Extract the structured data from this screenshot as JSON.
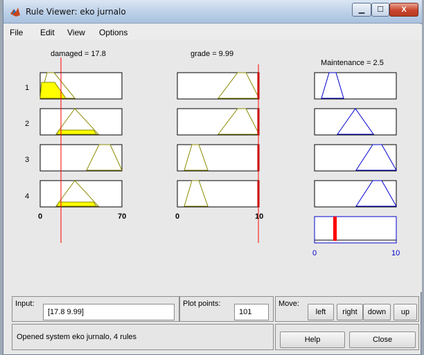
{
  "window": {
    "title": "Rule Viewer: eko jurnalo"
  },
  "titlebar_buttons": {
    "minimize": "▁",
    "maximize": "☐",
    "close": "X"
  },
  "menu": {
    "file": "File",
    "edit": "Edit",
    "view": "View",
    "options": "Options"
  },
  "inputs": [
    {
      "name": "damaged",
      "value": "17.8",
      "header": "damaged = 17.8",
      "range_min": "0",
      "range_max": "70"
    },
    {
      "name": "grade",
      "value": "9.99",
      "header": "grade = 9.99",
      "range_min": "0",
      "range_max": "10"
    }
  ],
  "output": {
    "name": "Maintenance",
    "value": "2.5",
    "header": "Maintenance = 2.5",
    "range_min": "0",
    "range_max": "10"
  },
  "rule_numbers": [
    "1",
    "2",
    "3",
    "4"
  ],
  "controls": {
    "input_label": "Input:",
    "input_value": "[17.8 9.99]",
    "plot_points_label": "Plot points:",
    "plot_points_value": "101",
    "move_label": "Move:",
    "left": "left",
    "right": "right",
    "down": "down",
    "up": "up",
    "help": "Help",
    "close": "Close"
  },
  "status": "Opened system eko jurnalo, 4 rules",
  "colors": {
    "mf_line": "#8a8a00",
    "mf_fill": "#ffff00",
    "output_line": "#0000cc",
    "marker": "#ff0000",
    "axis_label": "#0000cc"
  }
}
